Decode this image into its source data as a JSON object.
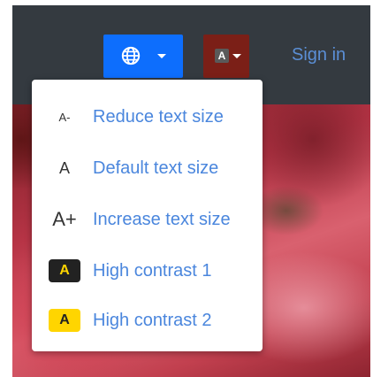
{
  "header": {
    "language_button": {
      "icon": "globe-icon",
      "color": "#0d6efd"
    },
    "text_size_button": {
      "icon_letter": "A",
      "color": "#7b1f17"
    },
    "signin_label": "Sign in",
    "signin_color": "#5b8fd6",
    "background_color": "#343a40"
  },
  "text_size_menu": {
    "items": [
      {
        "icon_text": "A-",
        "icon": "reduce-text-icon",
        "label": "Reduce text size"
      },
      {
        "icon_text": "A",
        "icon": "default-text-icon",
        "label": "Default text size"
      },
      {
        "icon_text": "A+",
        "icon": "increase-text-icon",
        "label": "Increase text size"
      },
      {
        "icon_text": "A",
        "icon": "high-contrast-dark-icon",
        "label": "High contrast 1"
      },
      {
        "icon_text": "A",
        "icon": "high-contrast-yellow-icon",
        "label": "High contrast 2"
      }
    ],
    "label_color": "#4a86dd",
    "contrast_yellow": "#ffd500",
    "contrast_dark": "#222222"
  }
}
